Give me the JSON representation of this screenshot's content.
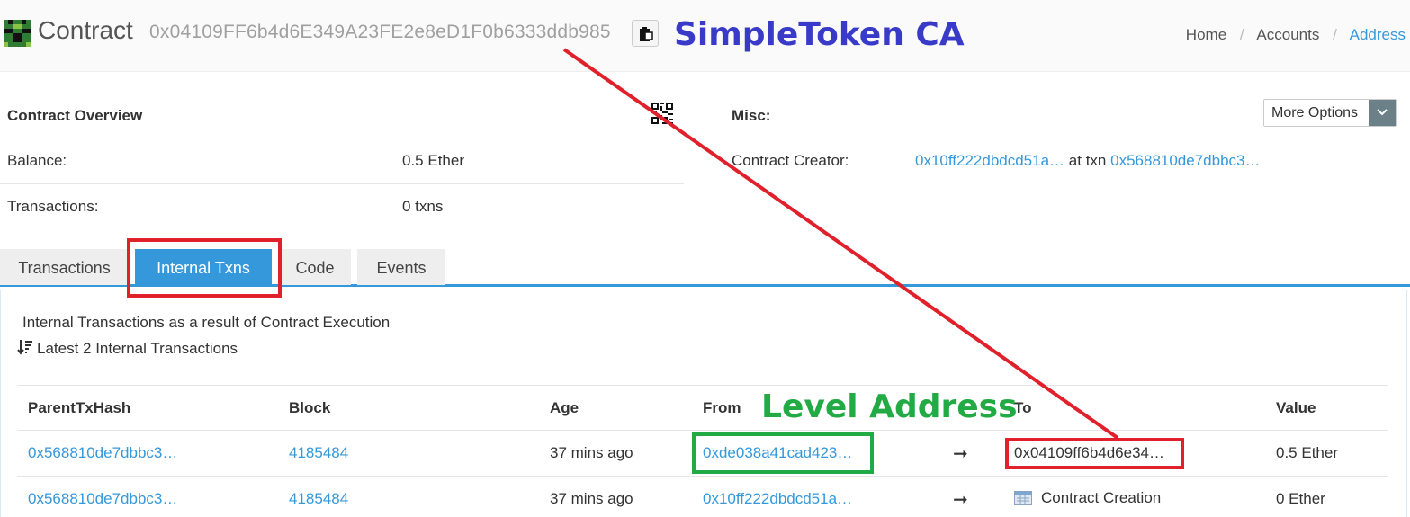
{
  "header": {
    "title": "Contract",
    "address": "0x04109FF6b4d6E349A23FE2e8eD1F0b6333ddb985",
    "annotation": "SimpleToken CA",
    "breadcrumb": [
      "Home",
      "Accounts",
      "Address"
    ]
  },
  "overview": {
    "title": "Contract Overview",
    "balance_label": "Balance:",
    "balance_value": "0.5 Ether",
    "transactions_label": "Transactions:",
    "transactions_value": "0 txns"
  },
  "misc": {
    "title": "Misc:",
    "more_options": "More Options",
    "creator_label": "Contract Creator:",
    "creator_address": "0x10ff222dbdcd51a…",
    "at_txn": "at txn",
    "creator_txn": "0x568810de7dbbc3…"
  },
  "tabs": [
    "Transactions",
    "Internal Txns",
    "Code",
    "Events"
  ],
  "content": {
    "description": "Internal Transactions as a result of Contract Execution",
    "latest": "Latest 2 Internal Transactions",
    "annotation": "Level Address",
    "columns": [
      "ParentTxHash",
      "Block",
      "Age",
      "From",
      "To",
      "Value"
    ],
    "rows": [
      {
        "parent": "0x568810de7dbbc3…",
        "block": "4185484",
        "age": "37 mins ago",
        "from": "0xde038a41cad423…",
        "arrow": "➞",
        "to": "0x04109ff6b4d6e34…",
        "value": "0.5 Ether"
      },
      {
        "parent": "0x568810de7dbbc3…",
        "block": "4185484",
        "age": "37 mins ago",
        "from": "0x10ff222dbdcd51a…",
        "arrow": "➞",
        "to": "Contract Creation",
        "value": "0 Ether"
      }
    ]
  },
  "colors": {
    "link": "#3498db",
    "tab_active": "#3498db",
    "annotation_red": "#e0202a",
    "annotation_green": "#22aa44",
    "annotation_blue": "#3a3ac8"
  }
}
